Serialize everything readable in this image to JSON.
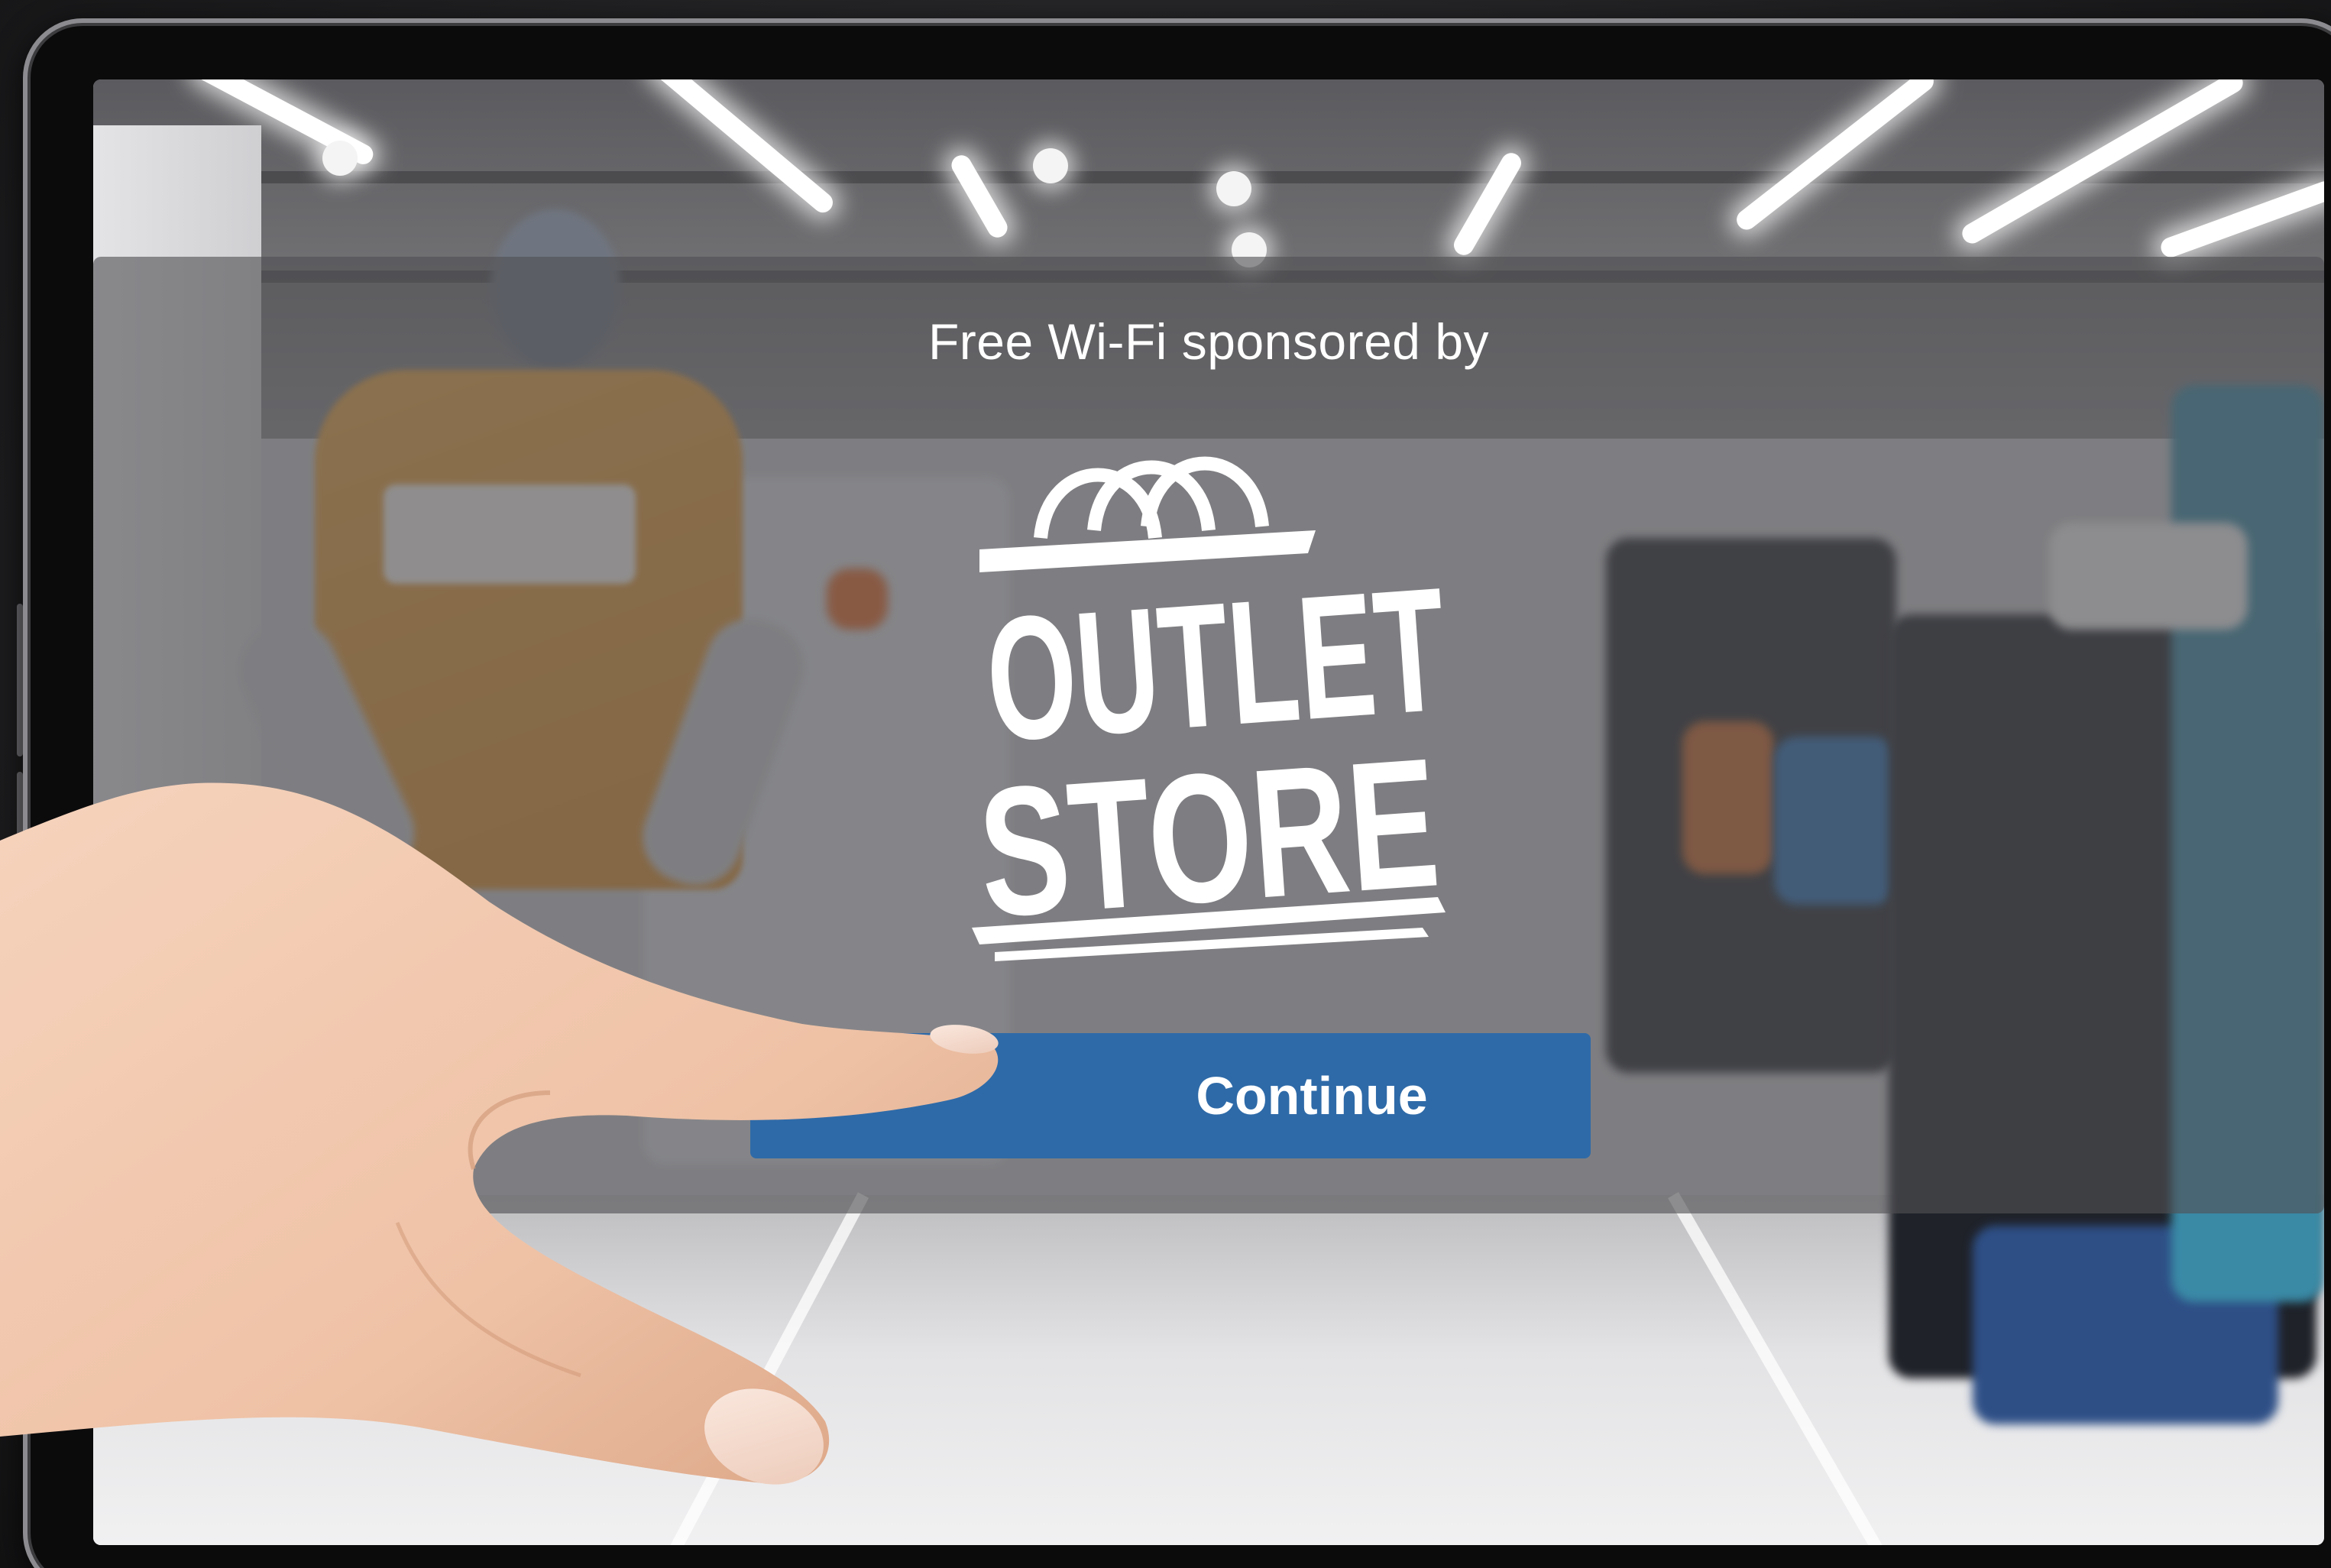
{
  "screen": {
    "sponsor_text": "Free Wi-Fi sponsored by",
    "logo": {
      "name": "outlet-store-logo",
      "line1": "OUTLET",
      "line2": "STORE"
    },
    "continue_label": "Continue"
  },
  "colors": {
    "button": "#2e6aa8",
    "panel_overlay": "rgba(80,80,84,0.62)",
    "shirt": "#e09a3a",
    "skin": "#f0c6ad"
  },
  "icons": [
    "tablet-frame",
    "hand-pointer",
    "shopping-store-logo"
  ]
}
